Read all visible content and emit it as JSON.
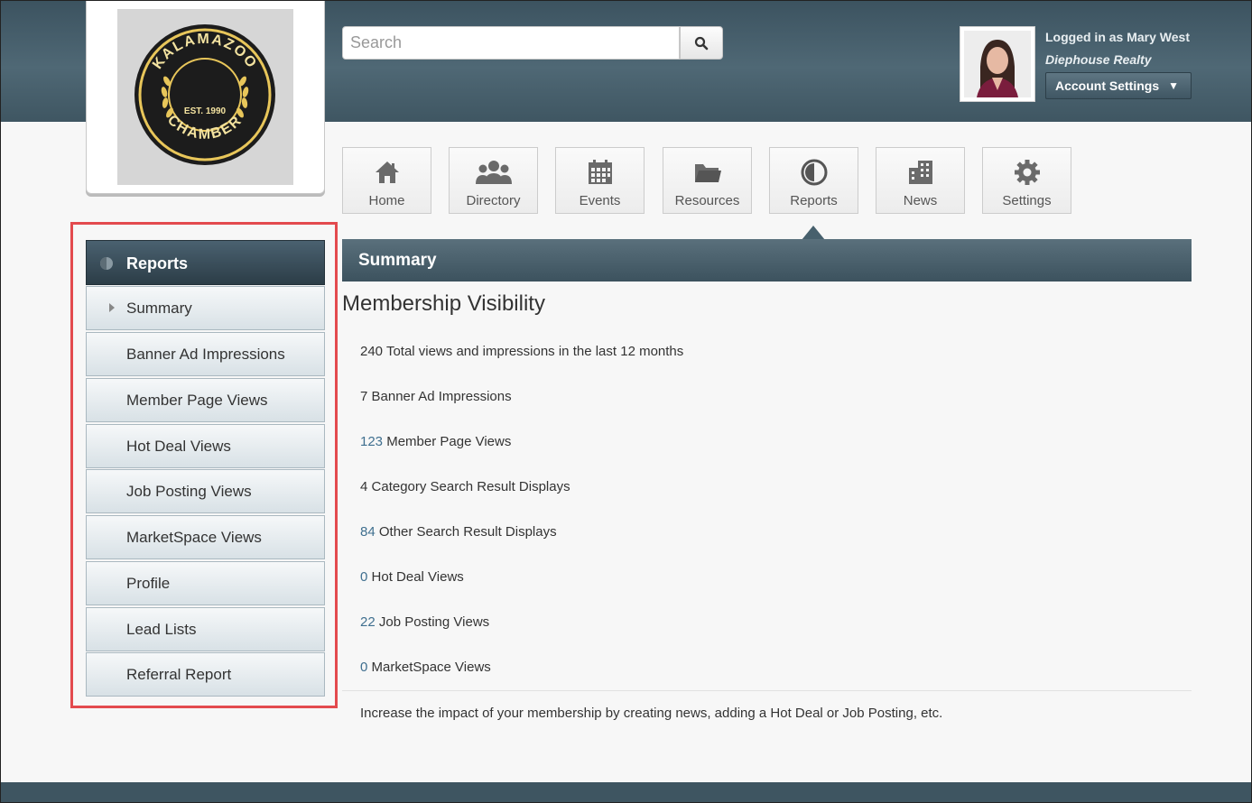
{
  "header": {
    "logo": {
      "top_text": "KALAMAZOO",
      "center_text": "EST. 1990",
      "bottom_text": "CHAMBER"
    },
    "search": {
      "placeholder": "Search"
    },
    "user": {
      "logged_in_text": "Logged in as Mary West",
      "company": "Diephouse Realty",
      "account_settings_label": "Account Settings"
    }
  },
  "nav": {
    "tiles": [
      {
        "label": "Home",
        "icon": "home-icon"
      },
      {
        "label": "Directory",
        "icon": "people-icon"
      },
      {
        "label": "Events",
        "icon": "calendar-icon"
      },
      {
        "label": "Resources",
        "icon": "folder-icon"
      },
      {
        "label": "Reports",
        "icon": "pie-chart-icon"
      },
      {
        "label": "News",
        "icon": "building-icon"
      },
      {
        "label": "Settings",
        "icon": "gear-icon"
      }
    ],
    "active": "Reports"
  },
  "sidebar": {
    "header": "Reports",
    "items": [
      {
        "label": "Summary"
      },
      {
        "label": "Banner Ad Impressions"
      },
      {
        "label": "Member Page Views"
      },
      {
        "label": "Hot Deal Views"
      },
      {
        "label": "Job Posting Views"
      },
      {
        "label": "MarketSpace Views"
      },
      {
        "label": "Profile"
      },
      {
        "label": "Lead Lists"
      },
      {
        "label": "Referral Report"
      }
    ]
  },
  "main": {
    "section_title": "Summary",
    "title": "Membership Visibility",
    "stats": [
      {
        "value": "240",
        "label": "Total views and impressions in the last 12 months"
      },
      {
        "value": "7",
        "label": "Banner Ad Impressions"
      },
      {
        "value": "123",
        "label": "Member Page Views"
      },
      {
        "value": "4",
        "label": "Category Search Result Displays"
      },
      {
        "value": "84",
        "label": "Other Search Result Displays"
      },
      {
        "value": "0",
        "label": "Hot Deal Views"
      },
      {
        "value": "22",
        "label": "Job Posting Views"
      },
      {
        "value": "0",
        "label": "MarketSpace Views"
      }
    ],
    "footer_note": "Increase the impact of your membership by creating news, adding a Hot Deal or Job Posting, etc."
  },
  "colors": {
    "header_bg": "#4f6875",
    "highlight_frame": "#e34a4e",
    "link": "#3f6f8f"
  }
}
